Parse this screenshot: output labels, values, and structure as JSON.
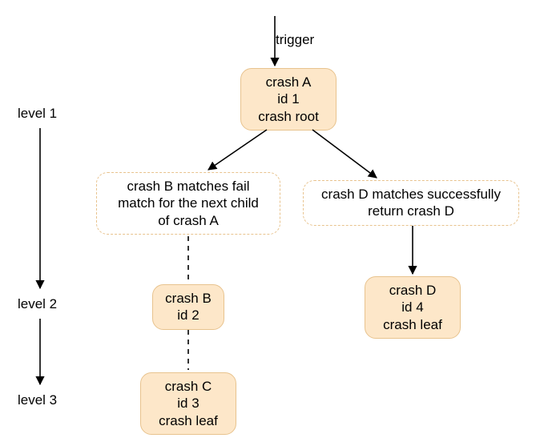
{
  "edge_labels": {
    "trigger": "trigger"
  },
  "levels": {
    "l1": "level 1",
    "l2": "level 2",
    "l3": "level 3"
  },
  "nodes": {
    "a": {
      "line1": "crash A",
      "line2": "id 1",
      "line3": "crash root"
    },
    "b_ghost": {
      "line1": "crash B matches fail",
      "line2": "match for the next child",
      "line3": "of crash A"
    },
    "d_ghost": {
      "line1": "crash D matches successfully",
      "line2": "return crash D"
    },
    "b": {
      "line1": "crash B",
      "line2": "id 2"
    },
    "c": {
      "line1": "crash C",
      "line2": "id 3",
      "line3": "crash leaf"
    },
    "d": {
      "line1": "crash D",
      "line2": "id 4",
      "line3": "crash leaf"
    }
  }
}
